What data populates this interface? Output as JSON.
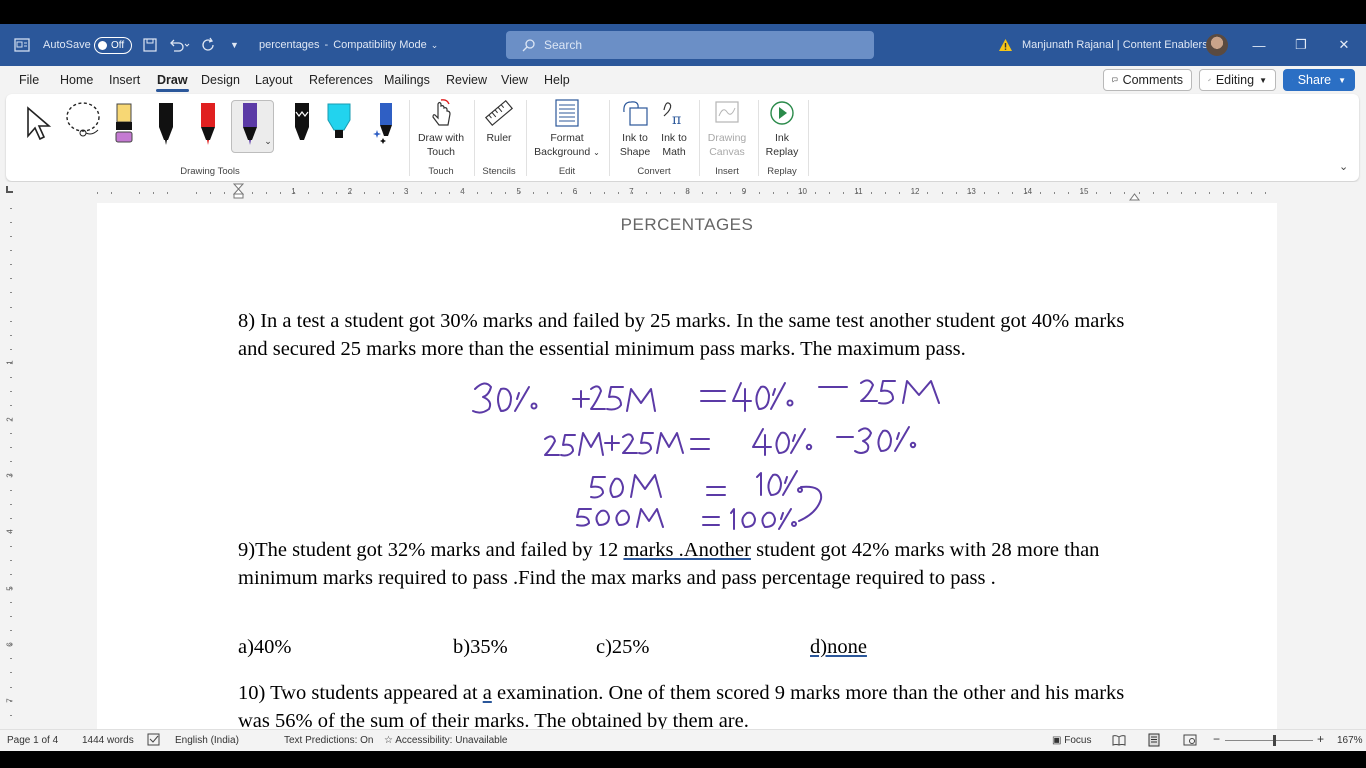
{
  "titlebar": {
    "autosave_label": "AutoSave",
    "autosave_state": "Off",
    "doc_name": "percentages",
    "doc_mode": "Compatibility Mode",
    "search_placeholder": "Search",
    "user": "Manjunath Rajanal | Content Enablers"
  },
  "menu": {
    "items": [
      "File",
      "Home",
      "Insert",
      "Draw",
      "Design",
      "Layout",
      "References",
      "Mailings",
      "Review",
      "View",
      "Help"
    ],
    "active": "Draw",
    "comments": "Comments",
    "editing": "Editing",
    "share": "Share"
  },
  "ribbon": {
    "groups": {
      "drawing_tools": "Drawing Tools",
      "touch": "Touch",
      "stencils": "Stencils",
      "edit": "Edit",
      "convert": "Convert",
      "insert": "Insert",
      "replay": "Replay"
    },
    "buttons": {
      "draw_with_touch_1": "Draw with",
      "draw_with_touch_2": "Touch",
      "ruler": "Ruler",
      "format_bg_1": "Format",
      "format_bg_2": "Background",
      "ink_shape_1": "Ink to",
      "ink_shape_2": "Shape",
      "ink_math_1": "Ink to",
      "ink_math_2": "Math",
      "drawing_canvas_1": "Drawing",
      "drawing_canvas_2": "Canvas",
      "ink_replay_1": "Ink",
      "ink_replay_2": "Replay"
    },
    "colors": {
      "pen_black": "#111111",
      "pen_red": "#e02020",
      "pen_purple": "#5b3aa6",
      "pen_cyan": "#22d3ee",
      "pen_blue": "#2f5fc4",
      "highlighter_yellow": "#f7d774",
      "highlighter_pink": "#c47ad2"
    }
  },
  "ruler": {
    "numbers": [
      "1",
      "2",
      "3",
      "4",
      "5",
      "6",
      "7",
      "8",
      "9",
      "10",
      "11",
      "12",
      "13",
      "14",
      "15"
    ],
    "vnumbers": [
      "1",
      "2",
      "3",
      "4",
      "5",
      "6",
      "7"
    ]
  },
  "document": {
    "header": "PERCENTAGES",
    "q8": "8) In a test a student got 30% marks and failed by 25 marks. In the same test another student got 40% marks and secured 25 marks more than the essential minimum pass marks. The maximum pass.",
    "q9_a": "9)The student got 32% marks and failed by 12 ",
    "q9_b": "marks .Another",
    "q9_c": " student got 42% marks with 28 more than minimum marks required to pass .Find the max marks and pass percentage required to pass .",
    "options": [
      "a)40%",
      "b)35%",
      "c)25%",
      "d)none"
    ],
    "q10_a": "10) Two students appeared at ",
    "q10_b": "a",
    "q10_c": " examination. One of them scored 9 marks more than the other and his marks was 56% of the sum of their marks. The obtained by them are.",
    "ink_color": "#5b3aa6",
    "ink_lines": [
      "30%  +25M  =40% — 25M",
      "25M+25M = 40% – 30%",
      "50M  = 10%",
      "500M  =100%"
    ]
  },
  "status": {
    "page": "Page 1 of 4",
    "words": "1444 words",
    "language": "English (India)",
    "predictions": "Text Predictions: On",
    "accessibility": "Accessibility: Unavailable",
    "focus": "Focus",
    "zoom": "167%"
  }
}
